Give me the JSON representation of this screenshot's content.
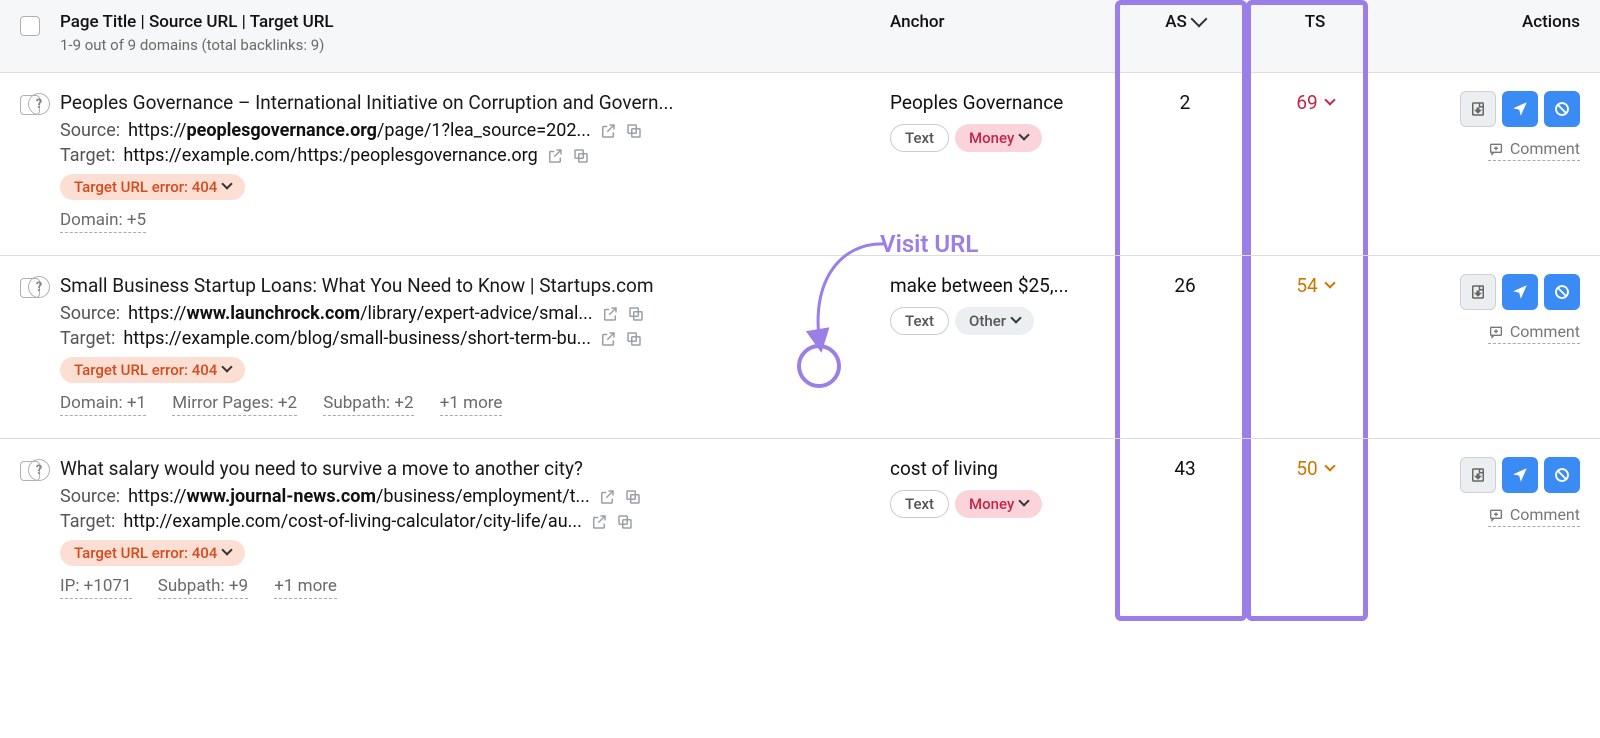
{
  "header": {
    "title_col": "Page Title | Source URL | Target URL",
    "subtitle": "1-9 out of 9 domains (total backlinks: 9)",
    "anchor": "Anchor",
    "as": "AS",
    "ts": "TS",
    "actions": "Actions"
  },
  "annotation": {
    "visit_url": "Visit URL"
  },
  "labels": {
    "source": "Source:",
    "target": "Target:",
    "comment": "Comment",
    "text_tag": "Text",
    "money_tag": "Money",
    "other_tag": "Other"
  },
  "rows": [
    {
      "title": "Peoples Governance – International Initiative on Corruption and Govern...",
      "source_pre": "https://",
      "source_bold": "peoplesgovernance.org",
      "source_post": "/page/1?lea_source=202...",
      "target": "https://example.com/https:/peoplesgovernance.org",
      "error": "Target URL error: 404",
      "meta": [
        "Domain: +5"
      ],
      "anchor": "Peoples Governance",
      "anchor_tags": [
        "Text",
        "Money"
      ],
      "as": "2",
      "ts": "69",
      "ts_class": "ts-red"
    },
    {
      "title": "Small Business Startup Loans: What You Need to Know | Startups.com",
      "source_pre": "https://",
      "source_bold": "www.launchrock.com",
      "source_post": "/library/expert-advice/smal...",
      "target": "https://example.com/blog/small-business/short-term-bu...",
      "error": "Target URL error: 404",
      "meta": [
        "Domain: +1",
        "Mirror Pages: +2",
        "Subpath: +2",
        "+1 more"
      ],
      "anchor": "make between $25,...",
      "anchor_tags": [
        "Text",
        "Other"
      ],
      "as": "26",
      "ts": "54",
      "ts_class": "ts-orange"
    },
    {
      "title": "What salary would you need to survive a move to another city?",
      "source_pre": "https://",
      "source_bold": "www.journal-news.com",
      "source_post": "/business/employment/t...",
      "target": "http://example.com/cost-of-living-calculator/city-life/au...",
      "error": "Target URL error: 404",
      "meta": [
        "IP: +1071",
        "Subpath: +9",
        "+1 more"
      ],
      "anchor": "cost of living",
      "anchor_tags": [
        "Text",
        "Money"
      ],
      "as": "43",
      "ts": "50",
      "ts_class": "ts-orange"
    }
  ]
}
